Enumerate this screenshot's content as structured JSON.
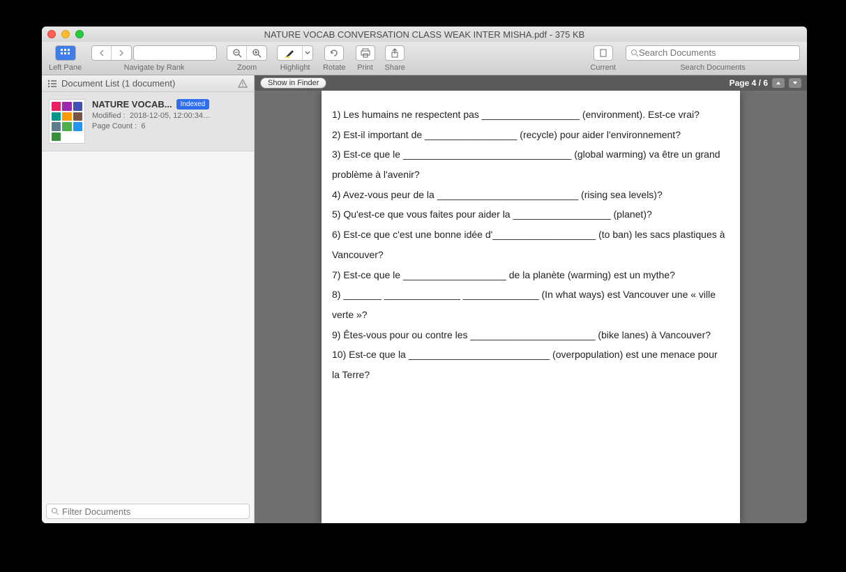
{
  "window": {
    "title": "NATURE VOCAB CONVERSATION CLASS WEAK INTER MISHA.pdf - 375 KB"
  },
  "toolbar": {
    "leftpane_label": "Left Pane",
    "navigate_label": "Navigate by Rank",
    "zoom_label": "Zoom",
    "highlight_label": "Highlight",
    "rotate_label": "Rotate",
    "print_label": "Print",
    "share_label": "Share",
    "current_label": "Current",
    "search_label": "Search Documents",
    "search_placeholder": "Search Documents"
  },
  "sidebar": {
    "header": "Document List (1 document)",
    "doc": {
      "title": "NATURE VOCAB...",
      "badge": "Indexed",
      "modified_label": "Modified :",
      "modified_value": "2018-12-05, 12:00:34…",
      "pagecount_label": "Page Count :",
      "pagecount_value": "6"
    },
    "filter_placeholder": "Filter Documents"
  },
  "content": {
    "show_finder": "Show in Finder",
    "page_indicator": "Page 4 / 6",
    "lines": [
      "1) Les humains ne respectent pas __________________ (environment). Est-ce vrai?",
      "2) Est-il important de _________________ (recycle) pour aider l'environnement?",
      "3) Est-ce que le _______________________________ (global warming) va être un grand problème à l'avenir?",
      "4) Avez-vous peur de la __________________________ (rising sea levels)?",
      "5) Qu'est-ce que vous faites pour aider la __________________ (planet)?",
      "6) Est-ce que c'est une bonne idée d'___________________ (to ban) les sacs plastiques à Vancouver?",
      "7) Est-ce que le ___________________ de la planète (warming) est un mythe?",
      "8) _______ ______________ ______________ (In what ways) est Vancouver une « ville verte »?",
      "9) Êtes-vous pour ou contre les _______________________ (bike lanes) à Vancouver?",
      "10) Est-ce que la __________________________ (overpopulation) est une menace pour la Terre?"
    ]
  }
}
